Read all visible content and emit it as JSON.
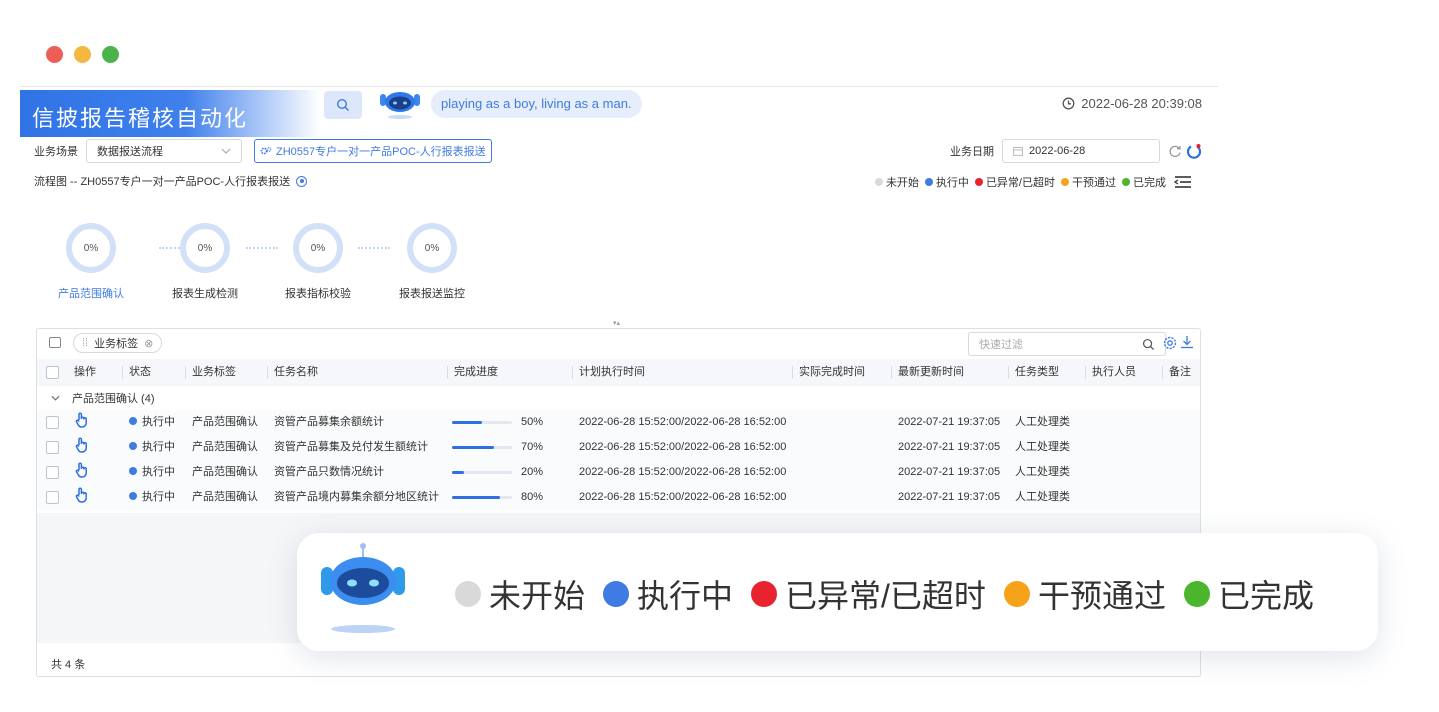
{
  "window_controls": {
    "colors": [
      "#ec5f57",
      "#f4b73f",
      "#4bb34c"
    ]
  },
  "header": {
    "title": "信披报告稽核自动化",
    "assistant_message": "playing as a boy, living as a man.",
    "datetime": "2022-06-28 20:39:08"
  },
  "filters": {
    "scene_label": "业务场景",
    "scene_value": "数据报送流程",
    "tag_button": "ZH0557专户一对一产品POC-人行报表报送",
    "date_label": "业务日期",
    "date_value": "2022-06-28"
  },
  "flow": {
    "title": "流程图 -- ZH0557专户一对一产品POC-人行报表报送",
    "steps": [
      {
        "label": "产品范围确认",
        "percent": "0%",
        "active": true
      },
      {
        "label": "报表生成检测",
        "percent": "0%",
        "active": false
      },
      {
        "label": "报表指标校验",
        "percent": "0%",
        "active": false
      },
      {
        "label": "报表报送监控",
        "percent": "0%",
        "active": false
      }
    ]
  },
  "legend": {
    "items": [
      {
        "label": "未开始",
        "color": "#d9d9d9"
      },
      {
        "label": "执行中",
        "color": "#3f7be3"
      },
      {
        "label": "已异常/已超时",
        "color": "#e8222e"
      },
      {
        "label": "干预通过",
        "color": "#f7a21b"
      },
      {
        "label": "已完成",
        "color": "#4bb52d"
      }
    ]
  },
  "table": {
    "chip": "业务标签",
    "quick_filter_placeholder": "快速过滤",
    "columns": [
      "操作",
      "状态",
      "业务标签",
      "任务名称",
      "完成进度",
      "计划执行时间",
      "实际完成时间",
      "最新更新时间",
      "任务类型",
      "执行人员",
      "备注"
    ],
    "group_label": "产品范围确认 (4)",
    "rows": [
      {
        "status": "执行中",
        "tag": "产品范围确认",
        "task": "资管产品募集余额统计",
        "progress": 50,
        "progress_label": "50%",
        "planned": "2022-06-28 15:52:00/2022-06-28 16:52:00",
        "actual": "",
        "updated": "2022-07-21 19:37:05",
        "type": "人工处理类",
        "assignee": "",
        "remark": ""
      },
      {
        "status": "执行中",
        "tag": "产品范围确认",
        "task": "资管产品募集及兑付发生额统计",
        "progress": 70,
        "progress_label": "70%",
        "planned": "2022-06-28 15:52:00/2022-06-28 16:52:00",
        "actual": "",
        "updated": "2022-07-21 19:37:05",
        "type": "人工处理类",
        "assignee": "",
        "remark": ""
      },
      {
        "status": "执行中",
        "tag": "产品范围确认",
        "task": "资管产品只数情况统计",
        "progress": 20,
        "progress_label": "20%",
        "planned": "2022-06-28 15:52:00/2022-06-28 16:52:00",
        "actual": "",
        "updated": "2022-07-21 19:37:05",
        "type": "人工处理类",
        "assignee": "",
        "remark": ""
      },
      {
        "status": "执行中",
        "tag": "产品范围确认",
        "task": "资管产品境内募集余额分地区统计",
        "progress": 80,
        "progress_label": "80%",
        "planned": "2022-06-28 15:52:00/2022-06-28 16:52:00",
        "actual": "",
        "updated": "2022-07-21 19:37:05",
        "type": "人工处理类",
        "assignee": "",
        "remark": ""
      }
    ],
    "footer": "共 4 条"
  },
  "callout": {
    "items": [
      {
        "label": "未开始",
        "color": "#d9d9d9"
      },
      {
        "label": "执行中",
        "color": "#3f7be3"
      },
      {
        "label": "已异常/已超时",
        "color": "#e8222e"
      },
      {
        "label": "干预通过",
        "color": "#f7a21b"
      },
      {
        "label": "已完成",
        "color": "#4bb52d"
      }
    ]
  }
}
